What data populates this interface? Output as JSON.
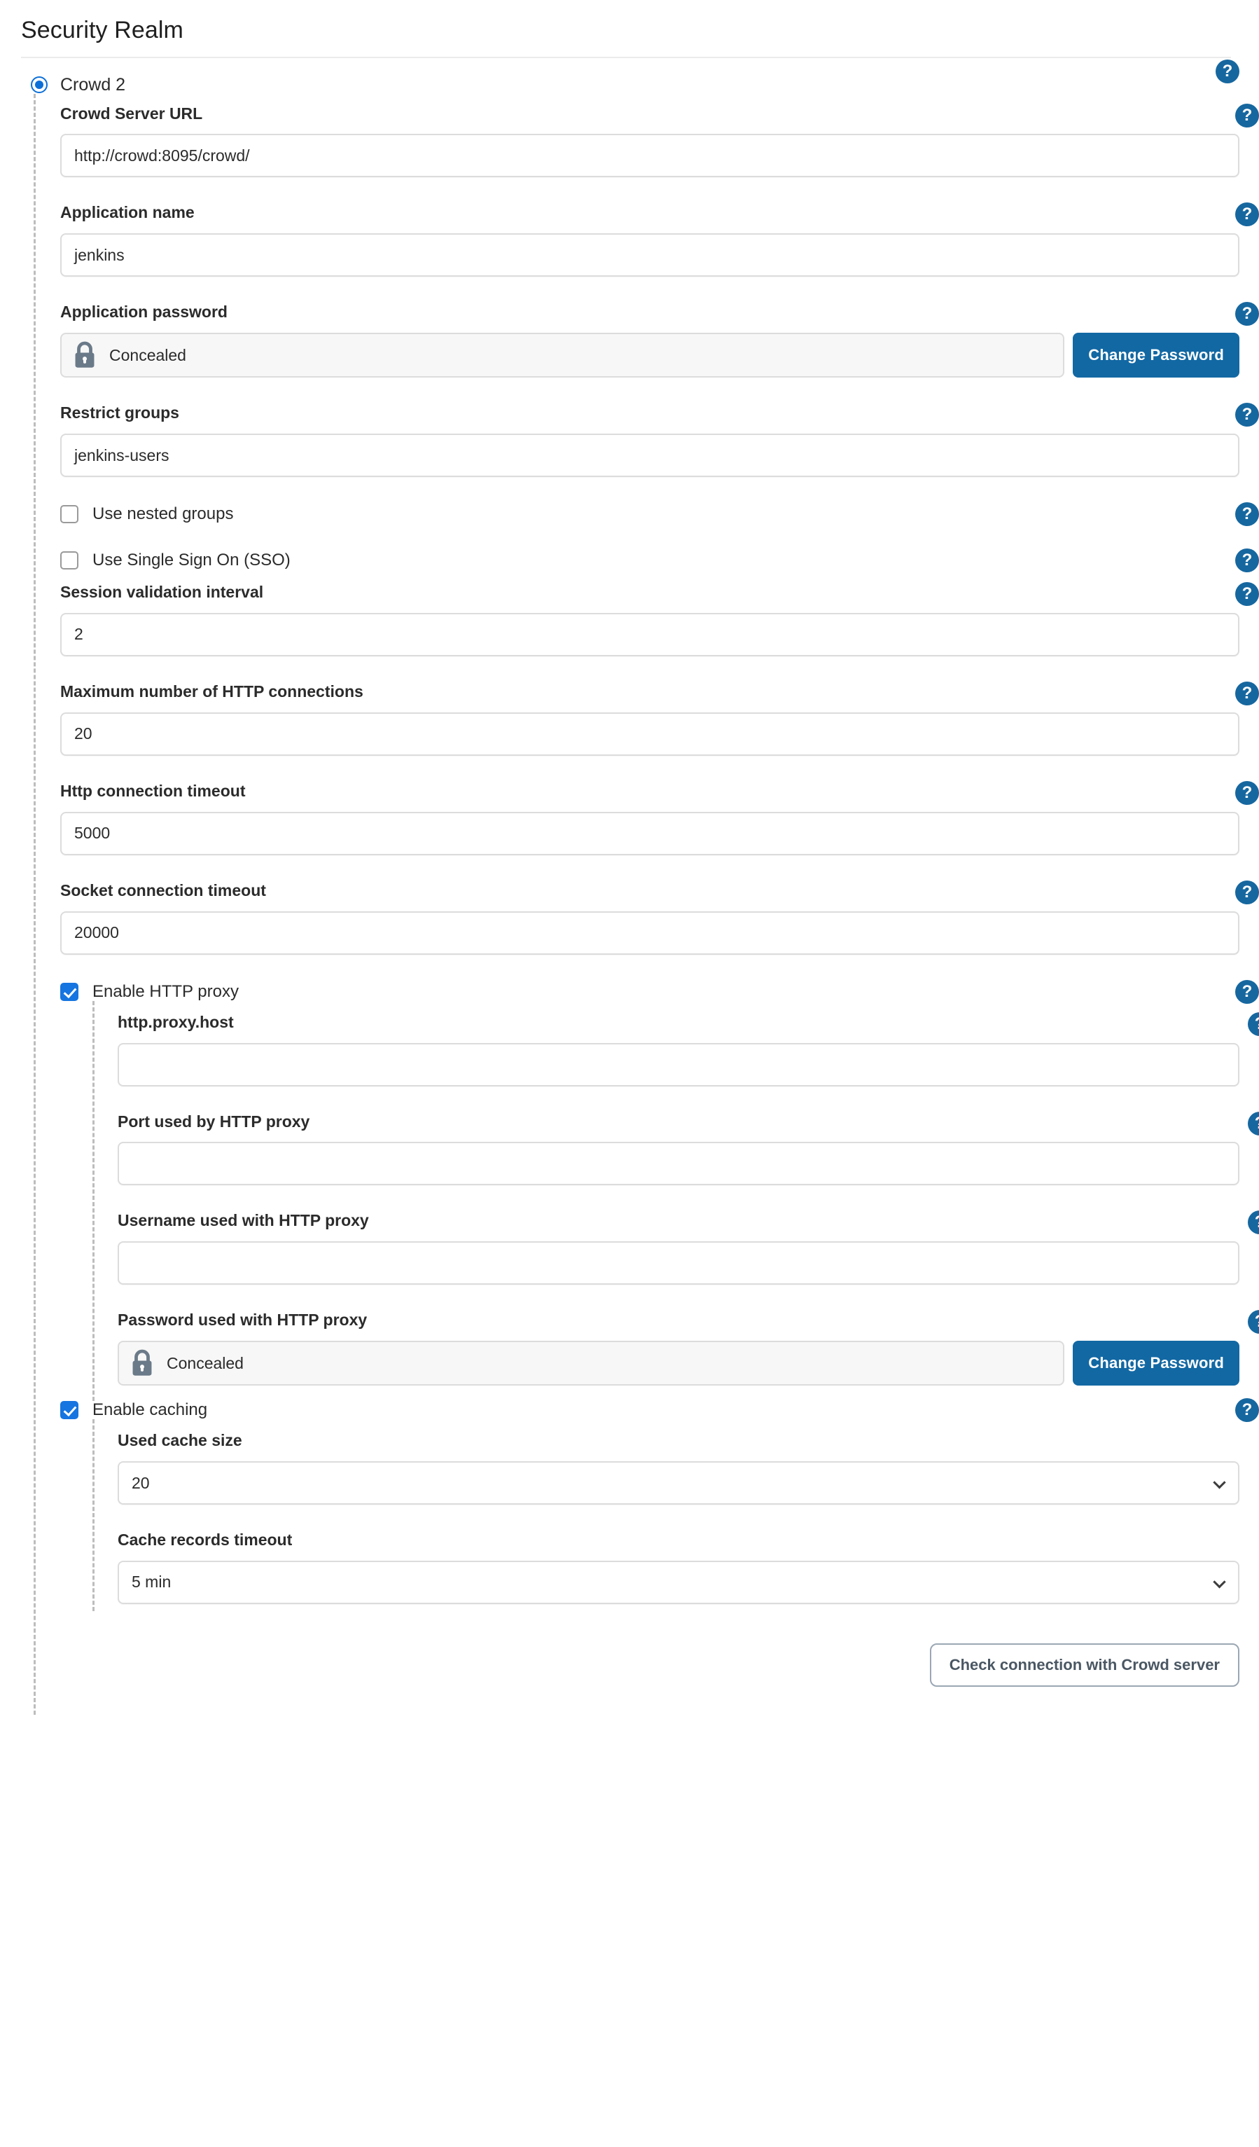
{
  "page": {
    "title": "Security Realm"
  },
  "realm": {
    "selected_label": "Crowd 2",
    "radio_state": "selected"
  },
  "icons": {
    "help": "?",
    "lock": "lock-icon",
    "chevron": "chevron-down-icon"
  },
  "colors": {
    "accent_blue": "#1268a3",
    "help_blue": "#16679f",
    "checkbox_blue": "#1675e0",
    "radio_blue": "#0b6fd8",
    "input_border": "#dcdcdc",
    "guide_dash": "#bdbdbd",
    "secondary_border": "#9ba7b3"
  },
  "fields": {
    "crowd_server_url": {
      "label": "Crowd Server URL",
      "value": "http://crowd:8095/crowd/",
      "placeholder": ""
    },
    "application_name": {
      "label": "Application name",
      "value": "jenkins",
      "placeholder": ""
    },
    "application_password": {
      "label": "Application password",
      "value": "Concealed",
      "button_label": "Change Password"
    },
    "restrict_groups": {
      "label": "Restrict groups",
      "value": "jenkins-users",
      "placeholder": ""
    },
    "use_nested_groups": {
      "label": "Use nested groups",
      "checked": false
    },
    "use_sso": {
      "label": "Use Single Sign On (SSO)",
      "checked": false
    },
    "session_validation_interval": {
      "label": "Session validation interval",
      "value": "2",
      "placeholder": ""
    },
    "max_http_connections": {
      "label": "Maximum number of HTTP connections",
      "value": "20",
      "placeholder": ""
    },
    "http_connection_timeout": {
      "label": "Http connection timeout",
      "value": "5000",
      "placeholder": ""
    },
    "socket_connection_timeout": {
      "label": "Socket connection timeout",
      "value": "20000",
      "placeholder": ""
    },
    "enable_http_proxy": {
      "label": "Enable HTTP proxy",
      "checked": true
    },
    "proxy_host": {
      "label": "http.proxy.host",
      "value": "",
      "placeholder": ""
    },
    "proxy_port": {
      "label": "Port used by HTTP proxy",
      "value": "",
      "placeholder": ""
    },
    "proxy_username": {
      "label": "Username used with HTTP proxy",
      "value": "",
      "placeholder": ""
    },
    "proxy_password": {
      "label": "Password used with HTTP proxy",
      "value": "Concealed",
      "button_label": "Change Password"
    },
    "enable_caching": {
      "label": "Enable caching",
      "checked": true
    },
    "cache_size": {
      "label": "Used cache size",
      "value": "20"
    },
    "cache_timeout": {
      "label": "Cache records timeout",
      "value": "5 min"
    }
  },
  "footer": {
    "check_connection_label": "Check connection with Crowd server"
  }
}
